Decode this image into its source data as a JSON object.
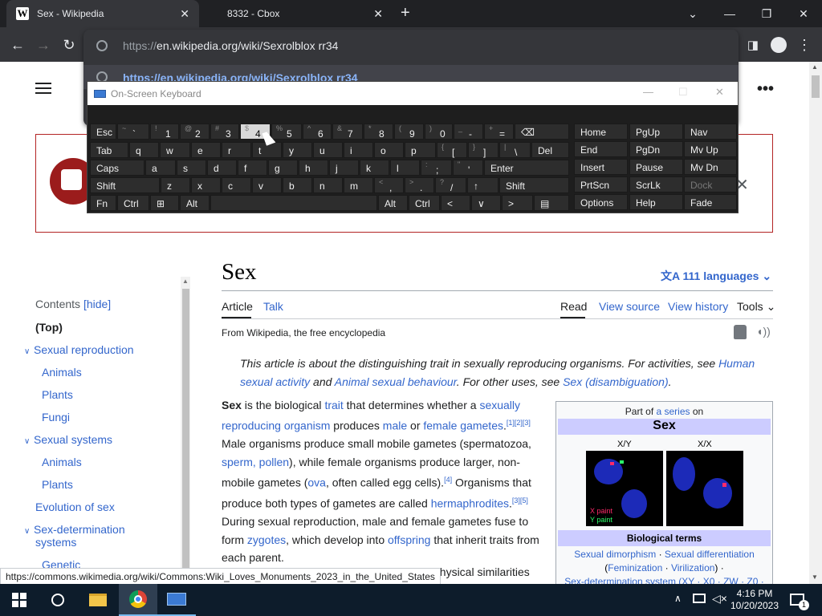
{
  "tabs": [
    {
      "title": "Sex - Wikipedia",
      "favicon": "W"
    },
    {
      "title": "8332 - Cbox"
    }
  ],
  "toolbar": {
    "url_prefix": "https://",
    "url_host": "en.wikipedia.org",
    "url_path": "/wiki/Sexrolblox rr34",
    "suggestion": "https://en.wikipedia.org/wiki/Sexrolblox rr34"
  },
  "osk": {
    "title": "On-Screen Keyboard",
    "row1": [
      {
        "k": "Esc"
      },
      {
        "k": "`",
        "s": "~"
      },
      {
        "k": "1",
        "s": "!"
      },
      {
        "k": "2",
        "s": "@"
      },
      {
        "k": "3",
        "s": "#"
      },
      {
        "k": "4",
        "s": "$"
      },
      {
        "k": "5",
        "s": "%"
      },
      {
        "k": "6",
        "s": "^"
      },
      {
        "k": "7",
        "s": "&"
      },
      {
        "k": "8",
        "s": "*"
      },
      {
        "k": "9",
        "s": "("
      },
      {
        "k": "0",
        "s": ")"
      },
      {
        "k": "-",
        "s": "_"
      },
      {
        "k": "=",
        "s": "+"
      },
      {
        "k": "⌫"
      }
    ],
    "row2": [
      "Tab",
      "q",
      "w",
      "e",
      "r",
      "t",
      "y",
      "u",
      "i",
      "o",
      "p",
      "[",
      "]",
      "\\",
      "Del"
    ],
    "row2_shift": [
      "",
      "",
      "",
      "",
      "",
      "",
      "",
      "",
      "",
      "",
      "",
      "{",
      "}",
      "|",
      ""
    ],
    "row3": [
      "Caps",
      "a",
      "s",
      "d",
      "f",
      "g",
      "h",
      "j",
      "k",
      "l",
      ";",
      "'",
      "Enter"
    ],
    "row3_shift": [
      "",
      "",
      "",
      "",
      "",
      "",
      "",
      "",
      "",
      "",
      ":",
      "\"",
      ""
    ],
    "row4": [
      "Shift",
      "z",
      "x",
      "c",
      "v",
      "b",
      "n",
      "m",
      ",",
      ".",
      "/",
      "↑",
      "Shift"
    ],
    "row4_shift": [
      "",
      "",
      "",
      "",
      "",
      "",
      "",
      "",
      "<",
      ">",
      "?",
      "",
      ""
    ],
    "row5": [
      "Fn",
      "Ctrl",
      "⊞",
      "Alt",
      "",
      "Alt",
      "Ctrl",
      "<",
      "∨",
      ">",
      "▤"
    ],
    "nav": [
      [
        "Home",
        "PgUp",
        "Nav"
      ],
      [
        "End",
        "PgDn",
        "Mv Up"
      ],
      [
        "Insert",
        "Pause",
        "Mv Dn"
      ],
      [
        "PrtScn",
        "ScrLk",
        "Dock"
      ],
      [
        "Options",
        "Help",
        "Fade"
      ]
    ],
    "pressed_key": "4"
  },
  "toc": {
    "header": "Contents",
    "hide": "[hide]",
    "items": [
      {
        "label": "(Top)",
        "level": 0,
        "bold": true
      },
      {
        "label": "Sexual reproduction",
        "level": 0,
        "caret": true
      },
      {
        "label": "Animals",
        "level": 1
      },
      {
        "label": "Plants",
        "level": 1
      },
      {
        "label": "Fungi",
        "level": 1
      },
      {
        "label": "Sexual systems",
        "level": 0,
        "caret": true
      },
      {
        "label": "Animals",
        "level": 1
      },
      {
        "label": "Plants",
        "level": 1
      },
      {
        "label": "Evolution of sex",
        "level": 0
      },
      {
        "label": "Sex-determination",
        "level": 0,
        "caret": true
      },
      {
        "label": "systems",
        "level": 0
      },
      {
        "label": "Genetic",
        "level": 1
      }
    ]
  },
  "article": {
    "title": "Sex",
    "languages": "111 languages",
    "tabs_left": [
      "Article",
      "Talk"
    ],
    "tabs_right": [
      "Read",
      "View source",
      "View history",
      "Tools"
    ],
    "from": "From Wikipedia, the free encyclopedia",
    "hatnote": {
      "a": "This article is about the distinguishing trait in sexually reproducing organisms. For activities, see ",
      "l1": "Human sexual activity",
      "b": " and ",
      "l2": "Animal sexual behaviour",
      "c": ". For other uses, see ",
      "l3": "Sex (disambiguation)",
      "d": "."
    },
    "body": {
      "bold": "Sex",
      "t1": " is the biological ",
      "l_trait": "trait",
      "t2": " that determines whether a ",
      "l_sro": "sexually reproducing organism",
      "t3": " produces ",
      "l_male": "male",
      "t4": " or ",
      "l_fg": "female gametes",
      "c1": "[1][2][3]",
      "t5": " Male organisms produce small mobile gametes (spermatozoa, ",
      "l_sperm": "sperm, pollen",
      "t6": "), while female organisms produce larger, non-mobile gametes (",
      "l_ova": "ova",
      "t7": ", often called egg cells).",
      "c2": "[4]",
      "t8": " Organisms that produce both types of gametes are called ",
      "l_herm": "hermaphrodites",
      "c3": "[3][5]",
      "t9": " During sexual reproduction, male and female gametes fuse to form ",
      "l_zyg": "zygotes",
      "t10": ", which develop into ",
      "l_off": "offspring",
      "t11": " that inherit traits from each parent.",
      "trail": "physical similarities"
    }
  },
  "infobox": {
    "part_of": "Part of ",
    "series_link": "a series",
    "on": " on",
    "heading": "Sex",
    "img_left_label": "X/Y",
    "img_right_label": "X/X",
    "x_paint": "X paint",
    "y_paint": "Y paint",
    "terms_head": "Biological terms",
    "line1_a": "Sexual dimorphism",
    "line1_b": "Sexual differentiation",
    "line2_a": "Feminization",
    "line2_b": "Virilization",
    "line3": "Sex-determination system (XY · X0 · ZW · Z0 ·"
  },
  "status_url": "https://commons.wikimedia.org/wiki/Commons:Wiki_Loves_Monuments_2023_in_the_United_States",
  "clock": {
    "time": "4:16 PM",
    "date": "10/20/2023"
  },
  "notifications": "1"
}
